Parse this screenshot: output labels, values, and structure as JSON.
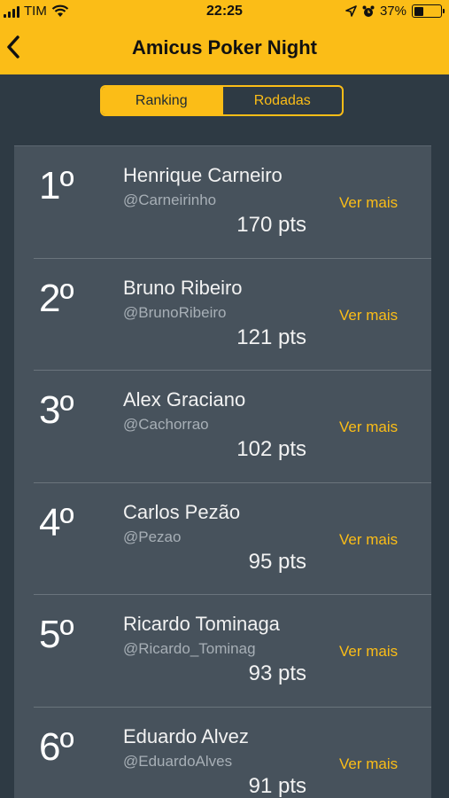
{
  "status_bar": {
    "carrier": "TIM",
    "time": "22:25",
    "battery_text": "37%",
    "battery_level": 0.37
  },
  "nav": {
    "title": "Amicus Poker Night"
  },
  "tabs": [
    {
      "label": "Ranking",
      "active": true
    },
    {
      "label": "Rodadas",
      "active": false
    }
  ],
  "ranking": [
    {
      "position": "1º",
      "name": "Henrique Carneiro",
      "handle": "@Carneirinho",
      "points": "170 pts",
      "link": "Ver mais"
    },
    {
      "position": "2º",
      "name": "Bruno Ribeiro",
      "handle": "@BrunoRibeiro",
      "points": "121 pts",
      "link": "Ver mais"
    },
    {
      "position": "3º",
      "name": "Alex Graciano",
      "handle": "@Cachorrao",
      "points": "102 pts",
      "link": "Ver mais"
    },
    {
      "position": "4º",
      "name": "Carlos Pezão",
      "handle": "@Pezao",
      "points": "95 pts",
      "link": "Ver mais"
    },
    {
      "position": "5º",
      "name": "Ricardo Tominaga",
      "handle": "@Ricardo_Tominag",
      "points": "93 pts",
      "link": "Ver mais"
    },
    {
      "position": "6º",
      "name": "Eduardo Alvez",
      "handle": "@EduardoAlves",
      "points": "91 pts",
      "link": "Ver mais"
    }
  ],
  "colors": {
    "accent": "#fbbd17",
    "background": "#2e3a44",
    "card": "#47525c"
  }
}
